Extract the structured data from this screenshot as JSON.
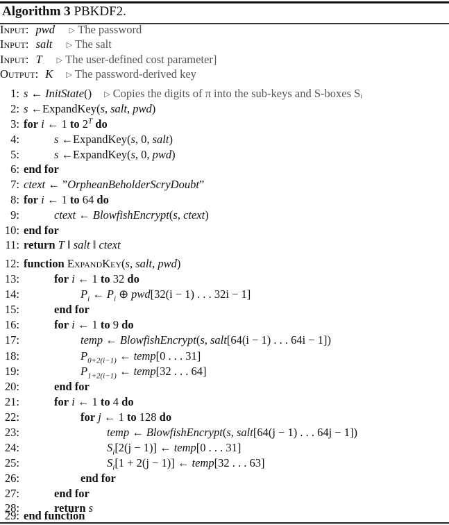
{
  "algorithm": {
    "label": "Algorithm 3",
    "name": "PBKDF2."
  },
  "io": [
    {
      "keyword": "Input:",
      "var": "pwd",
      "comment": "The password"
    },
    {
      "keyword": "Input:",
      "var": "salt",
      "comment": "The salt"
    },
    {
      "keyword": "Input:",
      "var": "T",
      "comment": "The user-defined cost parameter]"
    },
    {
      "keyword": "Output:",
      "var": "K",
      "comment": "The password-derived key"
    }
  ],
  "lines": [
    {
      "n": "1:",
      "code": "s ← InitState()",
      "comment": "Copies the digits of π into the sub-keys and S-boxes Sᵢ"
    },
    {
      "n": "2:",
      "code": "s ←ExpandKey(s, salt, pwd)"
    },
    {
      "n": "3:",
      "code": "for i ← 1 to 2^T do"
    },
    {
      "n": "4:",
      "code": "s ←ExpandKey(s, 0, salt)"
    },
    {
      "n": "5:",
      "code": "s ←ExpandKey(s, 0, pwd)"
    },
    {
      "n": "6:",
      "code": "end for"
    },
    {
      "n": "7:",
      "code": "ctext ← \"OrpheanBeholderScryDoubt\""
    },
    {
      "n": "8:",
      "code": "for i ← 1 to 64 do"
    },
    {
      "n": "9:",
      "code": "ctext ← BlowfishEncrypt(s, ctext)"
    },
    {
      "n": "10:",
      "code": "end for"
    },
    {
      "n": "11:",
      "code": "return T ‖ salt ‖ ctext"
    },
    {
      "n": "12:",
      "code": "function ExpandKey(s, salt, pwd)"
    },
    {
      "n": "13:",
      "code": "for i ← 1 to 32 do"
    },
    {
      "n": "14:",
      "code": "P_i ← P_i ⊕ pwd[32(i − 1) . . . 32i − 1]"
    },
    {
      "n": "15:",
      "code": "end for"
    },
    {
      "n": "16:",
      "code": "for i ← 1 to 9 do"
    },
    {
      "n": "17:",
      "code": "temp ← BlowfishEncrypt(s, salt[64(i − 1) . . . 64i − 1])"
    },
    {
      "n": "18:",
      "code": "P_{0+2(i−1)} ← temp[0 . . . 31]"
    },
    {
      "n": "19:",
      "code": "P_{1+2(i−1)} ← temp[32 . . . 64]"
    },
    {
      "n": "20:",
      "code": "end for"
    },
    {
      "n": "21:",
      "code": "for i ← 1 to 4 do"
    },
    {
      "n": "22:",
      "code": "for j ← 1 to 128 do"
    },
    {
      "n": "23:",
      "code": "temp ← BlowfishEncrypt(s, salt[64(j − 1) . . . 64j − 1])"
    },
    {
      "n": "24:",
      "code": "S_i[2(j − 1)] ← temp[0 . . . 31]"
    },
    {
      "n": "25:",
      "code": "S_i[1 + 2(j − 1)] ← temp[32 . . . 63]"
    },
    {
      "n": "26:",
      "code": "end for"
    },
    {
      "n": "27:",
      "code": "end for"
    },
    {
      "n": "28:",
      "code": "return s"
    },
    {
      "n": "29:",
      "code": "end function"
    }
  ],
  "tokens": {
    "arrow": "←",
    "tri": "▷",
    "kw_for": "for",
    "kw_to": "to",
    "kw_do": "do",
    "kw_end_for": "end for",
    "kw_return": "return",
    "kw_function": "function",
    "kw_end_function": "end function",
    "expandkey": "ExpandKey",
    "expandkey_sc": "ExpandKey",
    "initstate": "InitState",
    "blowfish": "BlowfishEncrypt",
    "s": "s",
    "i": "i",
    "j": "j",
    "T": "T",
    "salt": "salt",
    "pwd": "pwd",
    "ctext": "ctext",
    "temp": "temp",
    "P": "P",
    "S": "S",
    "zero": "0",
    "one": "1",
    "two": "2",
    "n9": "9",
    "n4": "4",
    "n32": "32",
    "n64": "64",
    "n128": "128",
    "str": "\"OrpheanBeholderScryDoubt\"",
    "str_open": "”",
    "str_body": "OrpheanBeholderScryDoubt",
    "str_close": "”",
    "parallel": "‖",
    "xor": "⊕",
    "idx_14": "[32(i − 1) . . . 32i − 1]",
    "idx_17": "[64(i − 1) . . . 64i − 1])",
    "idx_23": "[64(j − 1) . . . 64j − 1])",
    "sub_18": "0+2(i−1)",
    "sub_19": "1+2(i−1)",
    "rng_18": "[0 . . . 31]",
    "rng_19": "[32 . . . 64]",
    "rng_24": "[0 . . . 31]",
    "rng_25": "[32 . . . 63]",
    "lhs_24": "[2(j − 1)]",
    "lhs_25": "[1 + 2(j − 1)]"
  }
}
